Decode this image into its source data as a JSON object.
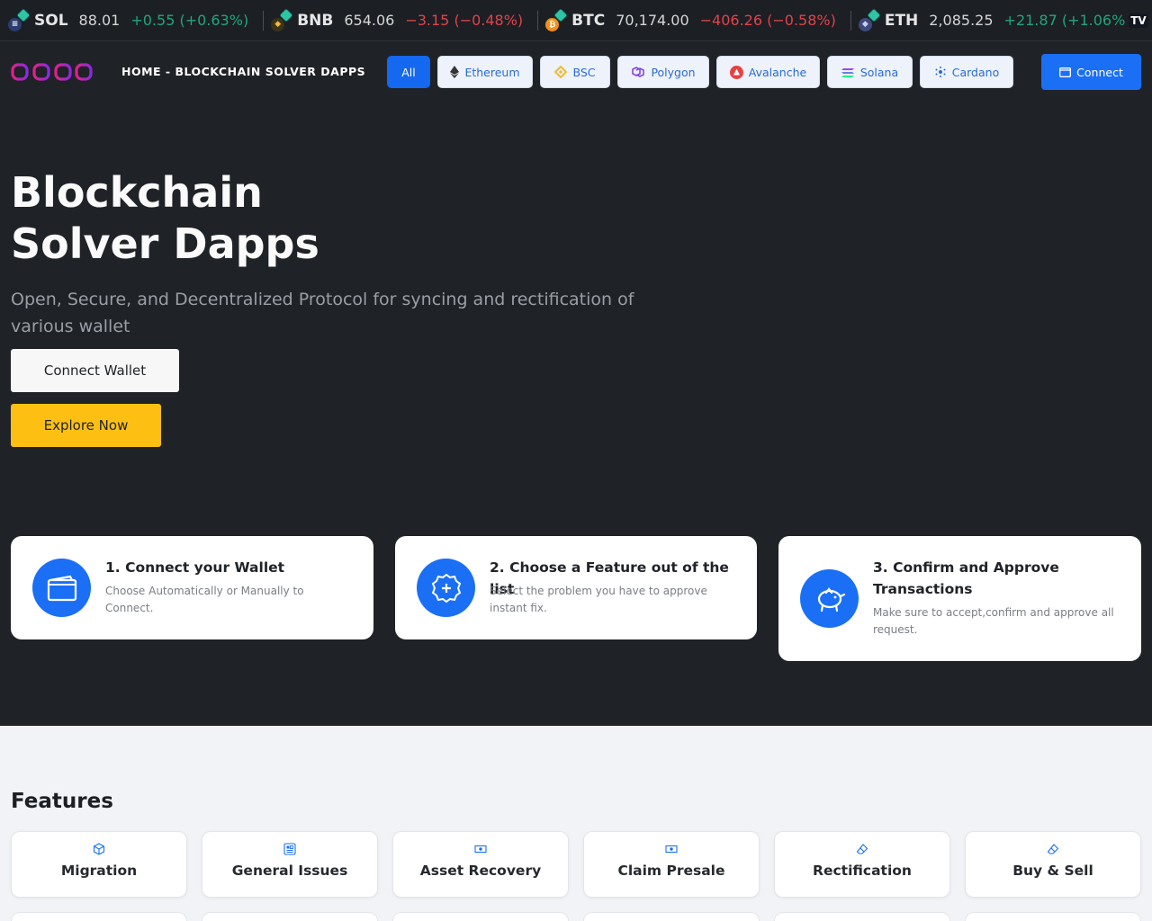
{
  "ticker": [
    {
      "symbol": "SOL",
      "price": "88.01",
      "change": "+0.55 (+0.63%)",
      "direction": "up",
      "coin_color": "#2b3d6e",
      "coin_glyph": "≡"
    },
    {
      "symbol": "BNB",
      "price": "654.06",
      "change": "−3.15 (−0.48%)",
      "direction": "down",
      "coin_color": "#3a3318",
      "coin_glyph": "◆"
    },
    {
      "symbol": "BTC",
      "price": "70,174.00",
      "change": "−406.26 (−0.58%)",
      "direction": "down",
      "coin_color": "#f0901a",
      "coin_glyph": "₿"
    },
    {
      "symbol": "ETH",
      "price": "2,085.25",
      "change": "+21.87 (+1.06%)",
      "direction": "up",
      "coin_color": "#3d4a7a",
      "coin_glyph": "◆"
    }
  ],
  "ticker_brand": "TV",
  "nav": {
    "breadcrumb": "HOME - BLOCKCHAIN SOLVER DAPPS",
    "chains": [
      {
        "label": "All",
        "icon": "none",
        "active": true
      },
      {
        "label": "Ethereum",
        "icon": "ethereum-icon",
        "active": false
      },
      {
        "label": "BSC",
        "icon": "bsc-icon",
        "active": false
      },
      {
        "label": "Polygon",
        "icon": "polygon-icon",
        "active": false
      },
      {
        "label": "Avalanche",
        "icon": "avalanche-icon",
        "active": false
      },
      {
        "label": "Solana",
        "icon": "solana-icon",
        "active": false
      },
      {
        "label": "Cardano",
        "icon": "cardano-icon",
        "active": false
      }
    ],
    "connect_label": "Connect"
  },
  "hero": {
    "title_line1": "Blockchain",
    "title_line2": "Solver Dapps",
    "subtitle": "Open, Secure, and Decentralized Protocol for syncing and rectification of various wallet",
    "connect_wallet_label": "Connect Wallet",
    "explore_label": "Explore Now"
  },
  "steps": [
    {
      "title": "1. Connect your Wallet",
      "desc": "Choose Automatically or Manually to Connect.",
      "icon": "wallet-icon"
    },
    {
      "title": "2. Choose a Feature out of the list",
      "desc": "Select the problem you have to approve instant fix.",
      "icon": "plus-badge-icon"
    },
    {
      "title": "3. Confirm and Approve Transactions",
      "desc": "Make sure to accept,confirm and approve all request.",
      "icon": "piggy-bank-icon"
    }
  ],
  "features": {
    "title": "Features",
    "items": [
      {
        "label": "Migration",
        "icon": "box-icon"
      },
      {
        "label": "General Issues",
        "icon": "grid-icon"
      },
      {
        "label": "Asset Recovery",
        "icon": "cash-icon"
      },
      {
        "label": "Claim Presale",
        "icon": "cash-icon"
      },
      {
        "label": "Rectification",
        "icon": "eraser-icon"
      },
      {
        "label": "Buy & Sell",
        "icon": "eraser-icon"
      }
    ]
  },
  "colors": {
    "accent": "#1a6ff5",
    "explore": "#fdc012",
    "dark_bg": "#1f2227",
    "up": "#22a67a",
    "down": "#e2434a",
    "logo_gradient": [
      "#e0218a",
      "#8a2be2"
    ]
  }
}
